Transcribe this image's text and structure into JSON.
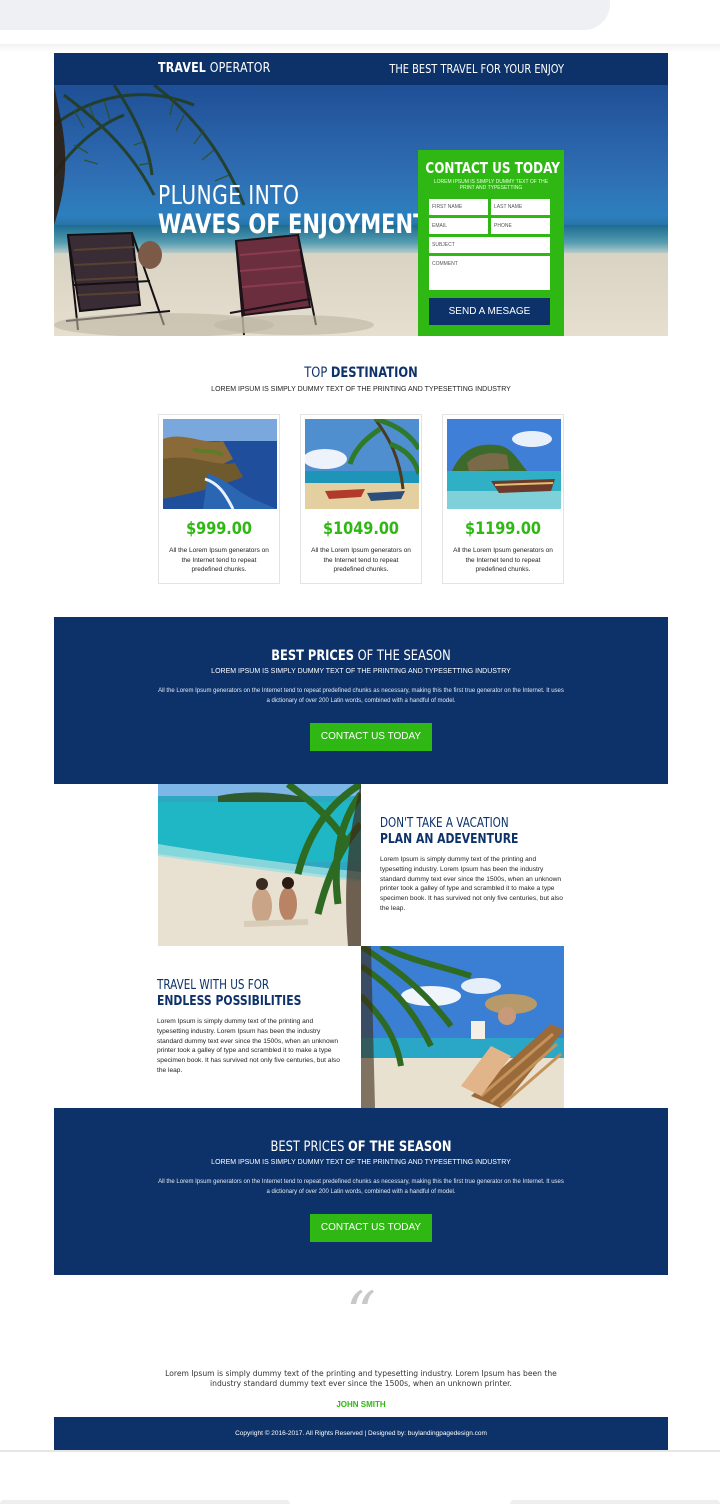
{
  "header": {
    "brand_bold": "TRAVEL",
    "brand_light": "OPERATOR",
    "tagline": "THE BEST TRAVEL FOR YOUR ENJOY"
  },
  "hero": {
    "line1": "PLUNGE INTO",
    "line2": "WAVES OF ENJOYMENT"
  },
  "contact_form": {
    "title": "CONTACT US TODAY",
    "subtitle": "LOREM IPSUM IS SIMPLY DUMMY TEXT OF THE PRINT AND TYPESETTING",
    "first_name": "FIRST NAME",
    "last_name": "LAST NAME",
    "email": "EMAIL",
    "phone": "PHONE",
    "subject": "SUBJECT",
    "comment": "COMMENT",
    "button": "SEND A MESAGE"
  },
  "destination": {
    "title_light": "TOP",
    "title_bold": "DESTINATION",
    "subtitle": "LOREM IPSUM IS SIMPLY DUMMY TEXT OF THE PRINTING AND TYPESETTING INDUSTRY",
    "cards": [
      {
        "price": "$999.00",
        "desc": "All the Lorem Ipsum generators on the Internet tend to repeat predefined chunks."
      },
      {
        "price": "$1049.00",
        "desc": "All the Lorem Ipsum generators on the Internet tend to repeat predefined chunks."
      },
      {
        "price": "$1199.00",
        "desc": "All the Lorem Ipsum generators on the Internet tend to repeat predefined chunks."
      }
    ]
  },
  "band1": {
    "title_bold": "BEST PRICES",
    "title_light": "OF THE SEASON",
    "subtitle": "LOREM IPSUM IS SIMPLY DUMMY TEXT OF THE PRINTING AND TYPESETTING INDUSTRY",
    "text": "All the Lorem Ipsum generators on the Internet tend to repeat predefined chunks as necessary, making this the first true generator on the Internet. It uses a dictionary of over 200 Latin words, combined with a handful of model.",
    "button": "CONTACT US TODAY"
  },
  "feature1": {
    "line1": "DON'T TAKE A VACATION",
    "line2": "PLAN AN ADEVENTURE",
    "body": "Lorem Ipsum is simply dummy text of the printing and typesetting industry. Lorem Ipsum has been the industry standard dummy text ever since the 1500s, when an unknown printer took a galley of type and scrambled it to make a type specimen book. It has survived not only five centuries, but also the leap."
  },
  "feature2": {
    "line1": "TRAVEL WITH US FOR",
    "line2": "ENDLESS POSSIBILITIES",
    "body": "Lorem Ipsum is simply dummy text of the printing and typesetting industry. Lorem Ipsum has been the industry standard dummy text ever since the 1500s, when an unknown printer took a galley of type and scrambled it to make a type specimen book. It has survived not only five centuries, but also the leap."
  },
  "band2": {
    "title_light": "BEST PRICES",
    "title_bold": "OF THE SEASON",
    "subtitle": "LOREM IPSUM IS SIMPLY DUMMY TEXT OF THE PRINTING AND TYPESETTING INDUSTRY",
    "text": "All the Lorem Ipsum generators on the Internet tend to repeat predefined chunks as necessary, making this the first true generator on the Internet. It uses a dictionary of over 200 Latin words, combined with a handful of model.",
    "button": "CONTACT US TODAY"
  },
  "testimonial": {
    "quote_mark": "“",
    "text": "Lorem Ipsum is simply dummy text of the printing and typesetting industry. Lorem Ipsum has been the industry standard dummy text ever since the 1500s, when an unknown printer.",
    "author": "JOHN SMITH"
  },
  "footer": {
    "text": "Copyright © 2016-2017. All Rights Reserved  |  Designed by: buylandingpagedesign.com"
  },
  "colors": {
    "navy": "#0d3269",
    "green": "#2fb813"
  }
}
